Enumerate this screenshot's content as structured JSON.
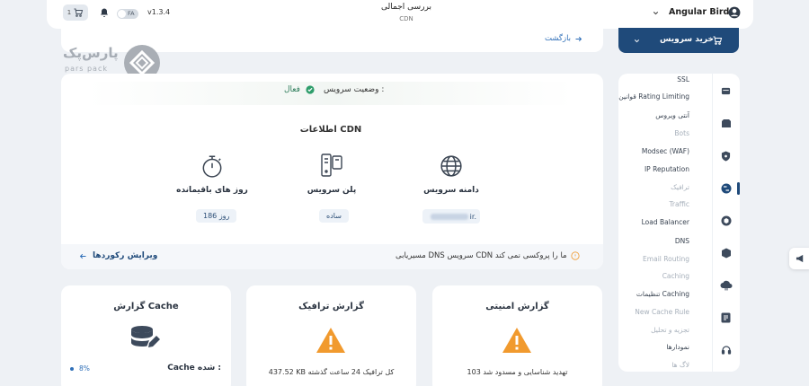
{
  "topbar": {
    "brand": "Angular Birds",
    "page_title": "بررسی اجمالی",
    "page_subtitle": "CDN",
    "version": "v1.3.4",
    "lang": "FA",
    "cart_count": "1"
  },
  "back": {
    "label": "بازگشت"
  },
  "buy": {
    "label": "خرید سرویس"
  },
  "logo": {
    "fa": "پارس‌پک",
    "en": "pars pack"
  },
  "status": {
    "label": "وضعیت سرویس :",
    "value": "فعال"
  },
  "cdn_info": {
    "title": "اطلاعات CDN",
    "domain": {
      "label": "دامنه سرویس",
      "value": "ir."
    },
    "plan": {
      "label": "پلن سرویس",
      "value": "ساده"
    },
    "days": {
      "label": "روز های باقیمانده",
      "value": "186 روز"
    }
  },
  "notice": {
    "text": "مسیریابی DNS سرویس CDN ما را پروکسی نمی کند",
    "edit_records": "ویرایش رکوردها"
  },
  "reports": {
    "security": {
      "title": "گزارش امنیتی",
      "text": "103 تهدید شناسایی و مسدود شد"
    },
    "traffic": {
      "title": "گزارش ترافیک",
      "text": "437.52 KB کل ترافیک 24 ساعت گذشته"
    },
    "cache": {
      "title": "گزارش Cache",
      "label": "Cache شده :",
      "value": "8%",
      "percent": 8
    }
  },
  "sidebar": {
    "items": [
      {
        "label": "SSL",
        "muted": false
      },
      {
        "label": "قوانین Rating Limiting",
        "muted": false
      },
      {
        "label": "آنتی ویروس",
        "muted": false
      },
      {
        "label": "Bots",
        "muted": true
      },
      {
        "label": "Modsec (WAF)",
        "muted": false
      },
      {
        "label": "IP Reputation",
        "muted": false
      },
      {
        "label": "ترافیک",
        "muted": true
      },
      {
        "label": "Traffic",
        "muted": true
      },
      {
        "label": "Load Balancer",
        "muted": false
      },
      {
        "label": "DNS",
        "muted": false
      },
      {
        "label": "Email Routing",
        "muted": true
      },
      {
        "label": "Caching",
        "muted": true
      },
      {
        "label": "تنظیمات Caching",
        "muted": false
      },
      {
        "label": "New Cache Rule",
        "muted": true
      },
      {
        "label": "تجزیه و تحلیل",
        "muted": true
      },
      {
        "label": "نمودارها",
        "muted": false
      },
      {
        "label": "لاگ ها",
        "muted": true
      }
    ]
  },
  "colors": {
    "accent": "#1f4a7a",
    "active": "#2e7d5b",
    "warning": "#f19a2e",
    "blue_link": "#2f6fb8"
  }
}
